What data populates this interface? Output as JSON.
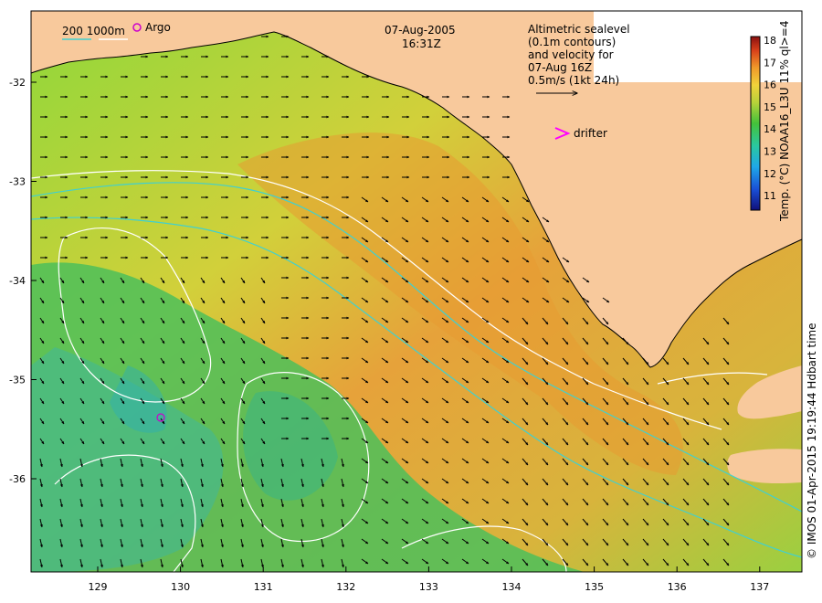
{
  "map": {
    "date": "07-Aug-2005",
    "time": "16:31Z",
    "depth_legend": "200  1000m",
    "argo_label": "Argo",
    "info_line1": "Altimetric sealevel",
    "info_line2": "(0.1m contours)",
    "info_line3": "and velocity for",
    "info_line4": "07-Aug 16Z",
    "info_line5": "0.5m/s (1kt 24h)",
    "drifter_label": "drifter",
    "colorbar_label": "Temp. (°C) NOAA16_L3U 11% ql>=4",
    "credit": "© IMOS 01-Apr-2015 19:19:44 Hdbart time",
    "lon_ticks": [
      "129",
      "130",
      "131",
      "132",
      "133",
      "134",
      "135",
      "136",
      "137"
    ],
    "lat_ticks": [
      "-32",
      "-33",
      "-34",
      "-35",
      "-36"
    ],
    "colorbar_ticks": [
      "18",
      "17",
      "16",
      "15",
      "14",
      "13",
      "12",
      "11"
    ],
    "colors": {
      "land": "#f8c99c",
      "cyan_contour": "#40d0d0",
      "white_contour": "#ffffff",
      "argo": "#cc00cc",
      "drifter": "#ff00ff"
    }
  }
}
